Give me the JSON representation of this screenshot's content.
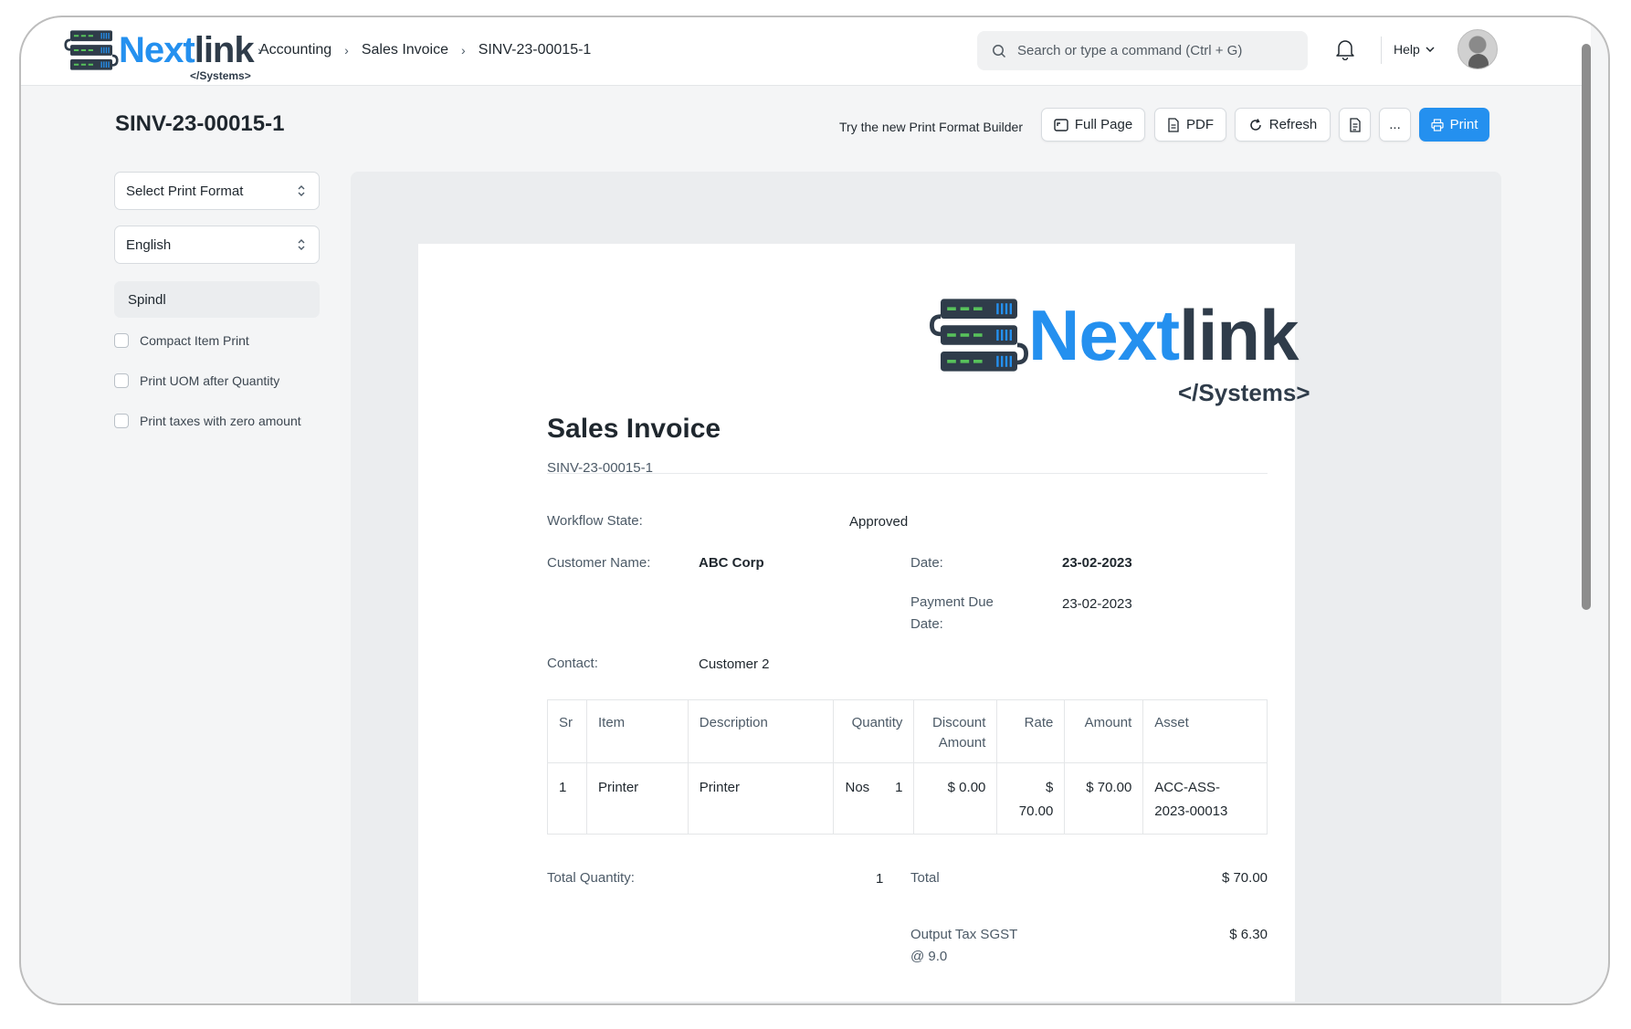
{
  "navbar": {
    "logo_word_a": "Next",
    "logo_word_b": "link",
    "logo_sub": "</Systems>",
    "breadcrumbs": [
      "Accounting",
      "Sales Invoice",
      "SINV-23-00015-1"
    ],
    "search_placeholder": "Search or type a command (Ctrl + G)",
    "help_label": "Help",
    "icons": {
      "search": "search-icon",
      "bell": "bell-icon",
      "chevron": "chevron-down-icon"
    }
  },
  "header": {
    "title": "SINV-23-00015-1",
    "print_format_builder_link": "Try the new Print Format Builder",
    "buttons": {
      "full_page": "Full Page",
      "pdf": "PDF",
      "refresh": "Refresh",
      "more": "...",
      "print": "Print"
    }
  },
  "sidebar": {
    "print_format_select": "Select Print Format",
    "language_select": "English",
    "letterhead": "Spindl",
    "checkboxes": [
      {
        "label": "Compact Item Print",
        "checked": false
      },
      {
        "label": "Print UOM after Quantity",
        "checked": false
      },
      {
        "label": "Print taxes with zero amount",
        "checked": false
      }
    ]
  },
  "document": {
    "logo_word_a": "Next",
    "logo_word_b": "link",
    "logo_sub": "</Systems>",
    "title": "Sales Invoice",
    "number": "SINV-23-00015-1",
    "fields": {
      "workflow_state_label": "Workflow State:",
      "workflow_state_value": "Approved",
      "customer_name_label": "Customer Name:",
      "customer_name_value": "ABC Corp",
      "date_label": "Date:",
      "date_value": "23-02-2023",
      "payment_due_label_1": "Payment Due",
      "payment_due_label_2": "Date:",
      "payment_due_value": "23-02-2023",
      "contact_label": "Contact:",
      "contact_value": "Customer 2"
    },
    "table": {
      "headers": [
        "Sr",
        "Item",
        "Description",
        "Quantity",
        "Discount",
        "Amount",
        "Rate",
        "Amount",
        "Asset"
      ],
      "rows": [
        {
          "sr": "1",
          "item": "Printer",
          "description": "Printer",
          "uom": "Nos",
          "qty": "1",
          "discount": "$ 0.00",
          "rate_1": "$",
          "rate_2": "70.00",
          "amount": "$ 70.00",
          "asset_1": "ACC-ASS-",
          "asset_2": "2023-00013"
        }
      ]
    },
    "totals": {
      "total_quantity_label": "Total Quantity:",
      "total_quantity_value": "1",
      "total_label": "Total",
      "total_value": "$ 70.00",
      "tax_label_1": "Output Tax SGST",
      "tax_label_2": "@ 9.0",
      "tax_value": "$ 6.30"
    }
  },
  "colors": {
    "brand_blue": "#2490ef",
    "brand_dark": "#2f3c4a",
    "server_green": "#57c15b"
  }
}
